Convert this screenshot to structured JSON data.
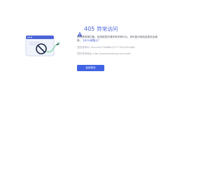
{
  "illustration": {
    "name": "blocked-browser-illustration",
    "colors": {
      "accent": "#4a63d8",
      "window_bg": "#f1f4fb",
      "block_icon": "#1f2a44",
      "line": "#6fd3a6"
    }
  },
  "error": {
    "code": "405",
    "title": "异常访问",
    "description": "您的请求被拦截，检测到您的请求有异常行为，将可能对网站造成安全威胁。",
    "description_link_label": "为什么被阻止？"
  },
  "meta": {
    "request_id_label": "您的请求ID:",
    "request_id_value": "fa2cc6a774886b1277732d78c4488",
    "request_url_label": "您的请求地址:",
    "request_url_value": "http://www.gaodingt.com/note"
  },
  "actions": {
    "primary_label": "返回首页"
  },
  "theme": {
    "accent": "#4a63d8",
    "button": "#3f63e3",
    "text": "#555a66",
    "muted": "#9aa0aa",
    "background": "#ffffff"
  }
}
